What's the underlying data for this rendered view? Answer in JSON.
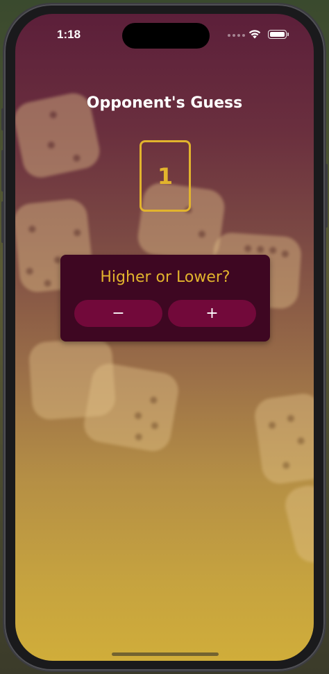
{
  "status_bar": {
    "time": "1:18"
  },
  "screen": {
    "title": "Opponent's Guess",
    "guess_value": "1"
  },
  "prompt_card": {
    "prompt": "Higher or Lower?",
    "lower_label": "−",
    "higher_label": "+"
  },
  "colors": {
    "accent_gold": "#e2b42d",
    "card_background": "#3e0722",
    "button_background": "#72093a",
    "gradient_top": "#5c1f3a",
    "gradient_bottom": "#d0ad3a"
  },
  "icons": [
    "wifi-icon",
    "battery-icon",
    "signal-dots-icon"
  ]
}
